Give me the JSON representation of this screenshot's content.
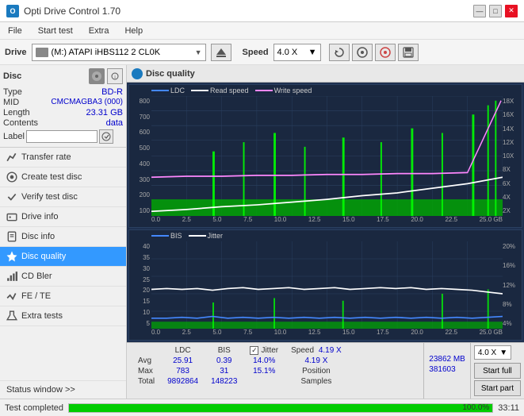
{
  "titleBar": {
    "icon": "O",
    "title": "Opti Drive Control 1.70",
    "minimizeLabel": "—",
    "maximizeLabel": "□",
    "closeLabel": "✕"
  },
  "menuBar": {
    "items": [
      "File",
      "Start test",
      "Extra",
      "Help"
    ]
  },
  "driveBar": {
    "driveLabel": "Drive",
    "driveValue": "(M:) ATAPI iHBS112  2 CL0K",
    "speedLabel": "Speed",
    "speedValue": "4.0 X"
  },
  "sidebar": {
    "discTitle": "Disc",
    "discFields": [
      {
        "label": "Type",
        "value": "BD-R"
      },
      {
        "label": "MID",
        "value": "CMCMAGBA3 (000)"
      },
      {
        "label": "Length",
        "value": "23.31 GB"
      },
      {
        "label": "Contents",
        "value": "data"
      }
    ],
    "labelLabel": "Label",
    "navItems": [
      {
        "id": "transfer-rate",
        "label": "Transfer rate",
        "icon": "📈"
      },
      {
        "id": "create-test-disc",
        "label": "Create test disc",
        "icon": "💿"
      },
      {
        "id": "verify-test-disc",
        "label": "Verify test disc",
        "icon": "✔"
      },
      {
        "id": "drive-info",
        "label": "Drive info",
        "icon": "ℹ"
      },
      {
        "id": "disc-info",
        "label": "Disc info",
        "icon": "📄"
      },
      {
        "id": "disc-quality",
        "label": "Disc quality",
        "icon": "★",
        "active": true
      },
      {
        "id": "cd-bler",
        "label": "CD Bler",
        "icon": "📊"
      },
      {
        "id": "fe-te",
        "label": "FE / TE",
        "icon": "📉"
      },
      {
        "id": "extra-tests",
        "label": "Extra tests",
        "icon": "🔧"
      }
    ],
    "statusWindow": "Status window >>"
  },
  "chart": {
    "title": "Disc quality",
    "topChart": {
      "legendItems": [
        "LDC",
        "Read speed",
        "Write speed"
      ],
      "yAxisLeft": [
        "800",
        "700",
        "600",
        "500",
        "400",
        "300",
        "200",
        "100"
      ],
      "yAxisRight": [
        "18X",
        "16X",
        "14X",
        "12X",
        "10X",
        "8X",
        "6X",
        "4X",
        "2X"
      ],
      "xAxis": [
        "0.0",
        "2.5",
        "5.0",
        "7.5",
        "10.0",
        "12.5",
        "15.0",
        "17.5",
        "20.0",
        "22.5",
        "25.0"
      ]
    },
    "bottomChart": {
      "legendItems": [
        "BIS",
        "Jitter"
      ],
      "yAxisLeft": [
        "40",
        "35",
        "30",
        "25",
        "20",
        "15",
        "10",
        "5"
      ],
      "yAxisRight": [
        "20%",
        "16%",
        "12%",
        "8%",
        "4%"
      ],
      "xAxis": [
        "0.0",
        "2.5",
        "5.0",
        "7.5",
        "10.0",
        "12.5",
        "15.0",
        "17.5",
        "20.0",
        "22.5",
        "25.0"
      ]
    }
  },
  "stats": {
    "headers": [
      "LDC",
      "BIS",
      "",
      "Jitter",
      "Speed"
    ],
    "rows": [
      {
        "label": "Avg",
        "ldc": "25.91",
        "bis": "0.39",
        "jitter": "14.0%",
        "speed": "4.19 X"
      },
      {
        "label": "Max",
        "ldc": "783",
        "bis": "31",
        "jitter": "15.1%",
        "position": "23862 MB"
      },
      {
        "label": "Total",
        "ldc": "9892864",
        "bis": "148223",
        "jitter": "",
        "samples": "381603"
      }
    ],
    "jitterLabel": "Jitter",
    "speedLabel": "Speed",
    "speedValue": "4.19 X",
    "speedSelectValue": "4.0 X",
    "positionLabel": "Position",
    "positionValue": "23862 MB",
    "samplesLabel": "Samples",
    "samplesValue": "381603",
    "startFullLabel": "Start full",
    "startPartLabel": "Start part"
  },
  "statusBar": {
    "statusText": "Test completed",
    "progressValue": 100,
    "progressText": "100.0%",
    "timeText": "33:11"
  }
}
